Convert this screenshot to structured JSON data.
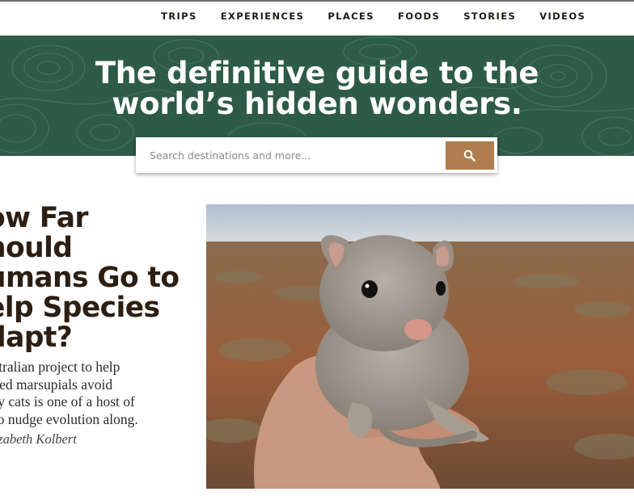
{
  "nav": {
    "items": [
      "TRIPS",
      "EXPERIENCES",
      "PLACES",
      "FOODS",
      "STORIES",
      "VIDEOS"
    ]
  },
  "hero": {
    "title_line1": "The definitive guide to the",
    "title_line2": "world’s hidden wonders."
  },
  "search": {
    "placeholder": "Search destinations and more...",
    "button_icon": "search-icon"
  },
  "article": {
    "headline_lines": [
      "ow Far",
      "hould",
      "umans Go to",
      "elp Species",
      "dapt?"
    ],
    "dek_lines": [
      "Australian project to help",
      "atened marsupials avoid",
      "atory cats is one of a host of",
      "rts to nudge evolution along."
    ],
    "byline": "lizabeth Kolbert",
    "image_subject": "small marsupial held in a hand over outback scrubland"
  },
  "colors": {
    "hero_bg": "#2e5a48",
    "search_button": "#b07d4f",
    "headline": "#2c1e12"
  }
}
